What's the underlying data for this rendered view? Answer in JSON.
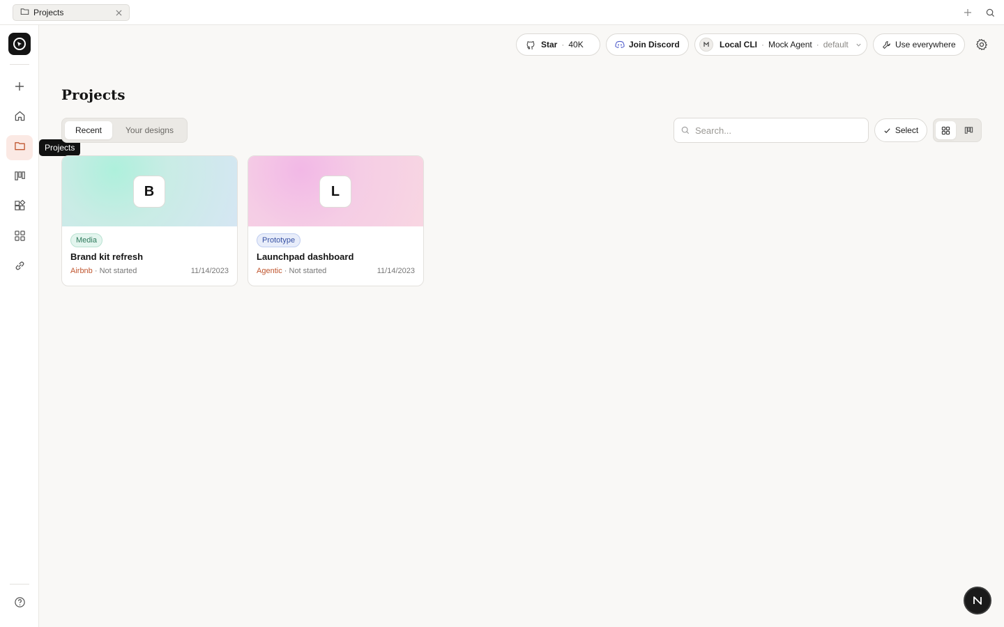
{
  "tabbar": {
    "tab_label": "Projects",
    "tab_icon": "folder-icon",
    "right_icons": [
      "plus-icon",
      "search-icon"
    ]
  },
  "sidebar": {
    "items": [
      {
        "icon": "plus-icon",
        "active": false
      },
      {
        "icon": "home-icon",
        "active": false
      },
      {
        "icon": "folder-icon",
        "active": true
      },
      {
        "icon": "kanban-icon",
        "active": false
      },
      {
        "icon": "components-icon",
        "active": false
      },
      {
        "icon": "grid-icon",
        "active": false
      },
      {
        "icon": "link-icon",
        "active": false
      }
    ],
    "bottom_icon": "help-icon",
    "tooltip": "Projects"
  },
  "header": {
    "star_label": "Star",
    "star_count": "40K",
    "discord_label": "Join Discord",
    "agent_label": "Local CLI",
    "agent_name": "Mock Agent",
    "agent_mode": "default",
    "use_everywhere_label": "Use everywhere"
  },
  "main": {
    "title": "Projects",
    "tabs": [
      {
        "label": "Recent",
        "active": true
      },
      {
        "label": "Your designs",
        "active": false
      }
    ],
    "search_placeholder": "Search...",
    "select_label": "Select",
    "view_modes": [
      "grid-view-icon",
      "board-view-icon"
    ],
    "projects": [
      {
        "initial": "B",
        "badge": "Media",
        "title": "Brand kit refresh",
        "client": "Airbnb",
        "status": "Not started",
        "date": "11/14/2023"
      },
      {
        "initial": "L",
        "badge": "Prototype",
        "title": "Launchpad dashboard",
        "client": "Agentic",
        "status": "Not started",
        "date": "11/14/2023"
      }
    ]
  },
  "fab": {
    "label": "N"
  },
  "colors": {
    "accent": "#c0562f",
    "active_nav_bg": "#fbe9e4",
    "page_bg": "#f9f8f6"
  }
}
